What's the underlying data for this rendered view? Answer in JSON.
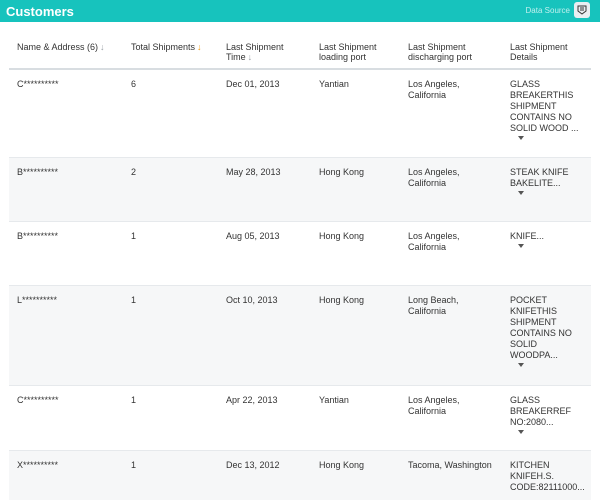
{
  "header": {
    "title": "Customers",
    "link_text": "Data Source"
  },
  "columns": [
    {
      "label": "Name & Address (6)",
      "sort": "gray"
    },
    {
      "label": "Total Shipments",
      "sort": "orange"
    },
    {
      "label": "Last Shipment Time",
      "sort": "gray"
    },
    {
      "label": "Last Shipment loading port",
      "sort": ""
    },
    {
      "label": "Last Shipment discharging port",
      "sort": ""
    },
    {
      "label": "Last Shipment Details",
      "sort": ""
    }
  ],
  "rows": [
    {
      "name": "C**********",
      "total": "6",
      "time": "Dec 01, 2013",
      "loading": "Yantian",
      "discharging": "Los Angeles, California",
      "details": "GLASS BREAKERTHIS SHIPMENT CONTAINS NO SOLID WOOD ..."
    },
    {
      "name": "B**********",
      "total": "2",
      "time": "May 28, 2013",
      "loading": "Hong Kong",
      "discharging": "Los Angeles, California",
      "details": "STEAK KNIFE BAKELITE..."
    },
    {
      "name": "B**********",
      "total": "1",
      "time": "Aug 05, 2013",
      "loading": "Hong Kong",
      "discharging": "Los Angeles, California",
      "details": "KNIFE..."
    },
    {
      "name": "L**********",
      "total": "1",
      "time": "Oct 10, 2013",
      "loading": "Hong Kong",
      "discharging": "Long Beach, California",
      "details": "POCKET KNIFETHIS SHIPMENT CONTAINS NO SOLID WOODPA..."
    },
    {
      "name": "C**********",
      "total": "1",
      "time": "Apr 22, 2013",
      "loading": "Yantian",
      "discharging": "Los Angeles, California",
      "details": "GLASS BREAKERREF NO:2080..."
    },
    {
      "name": "X**********",
      "total": "1",
      "time": "Dec 13, 2012",
      "loading": "Hong Kong",
      "discharging": "Tacoma, Washington",
      "details": "KITCHEN KNIFEH.S. CODE:82111000..."
    }
  ]
}
